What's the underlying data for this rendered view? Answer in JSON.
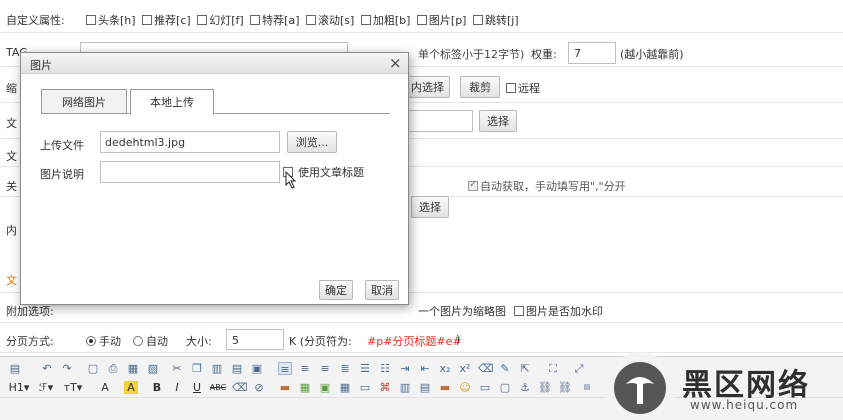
{
  "form": {
    "custom_attr_label": "自定义属性:",
    "custom_attrs": [
      "头条[h]",
      "推荐[c]",
      "幻灯[f]",
      "特荐[a]",
      "滚动[s]",
      "加粗[b]",
      "图片[p]",
      "跳转[j]"
    ],
    "tag_label": "TAG",
    "tag_hint": "单个标签小于12字节)",
    "weight_label": "权重:",
    "weight_value": "7",
    "weight_hint": "(越小越靠前)",
    "thumb_label": "缩",
    "thumb_select_partial": "内选择",
    "crop_button": "裁剪",
    "remote_label": "远程",
    "select_button": "选择",
    "row4_label": "文",
    "row5_label": "文",
    "keywords_label": "关",
    "auto_fetch_label": "自动获取，手动填写用\",\"分开",
    "content_label": "内",
    "section_label_partial": "文",
    "attach_label_partial": "附加选项:",
    "first_pic_partial": "一个图片为缩略图",
    "watermark_label": "图片是否加水印",
    "paging_label": "分页方式:",
    "paging_manual": "手动",
    "paging_auto": "自动",
    "size_label": "大小:",
    "size_value": "5",
    "size_hint": "K (分页符为:",
    "page_marker": "#p#分页标题#e#",
    "page_marker_close": ")"
  },
  "dialog": {
    "title": "图片",
    "close_glyph": "×",
    "tabs": [
      "网络图片",
      "本地上传"
    ],
    "upload_label": "上传文件",
    "upload_value": "dedehtml3.jpg",
    "browse_button": "浏览...",
    "desc_label": "图片说明",
    "desc_value": "",
    "use_title_label": "使用文章标题",
    "ok_button": "确定",
    "cancel_button": "取消"
  },
  "toolbar": {
    "row2_labels": [
      "H1",
      "ℱ",
      "тT"
    ],
    "row2_format": [
      "A",
      "A",
      "B",
      "I",
      "U",
      "ABC",
      "x₂",
      "x²"
    ]
  },
  "watermark": {
    "site_name": "黑区网络",
    "site_url": "www.heiqu.com"
  },
  "colors": {
    "accent_red": "#e0301e",
    "orange_label": "#e07a0c"
  }
}
